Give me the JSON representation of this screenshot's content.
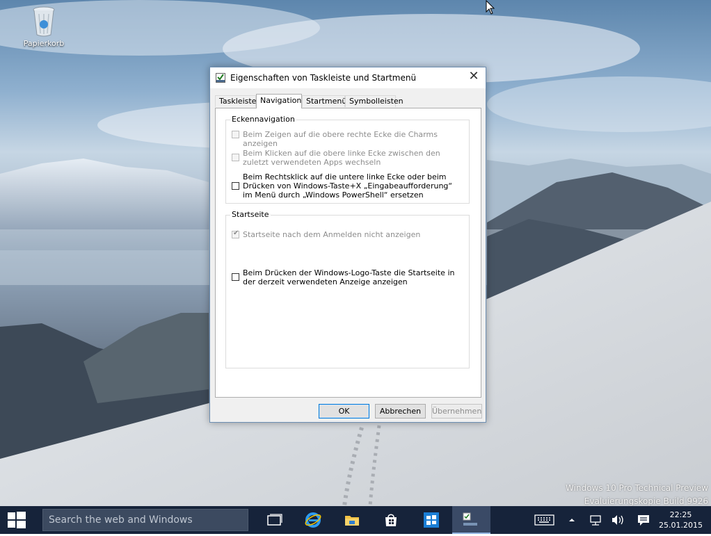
{
  "desktop": {
    "recycle_bin_label": "Papierkorb",
    "watermark_line1": "Windows 10 Pro Technical Preview",
    "watermark_line2": "Evaluierungskopie Build 9926"
  },
  "dialog": {
    "title": "Eigenschaften von Taskleiste und Startmenü",
    "close_glyph": "✕",
    "tabs": [
      {
        "label": "Taskleiste",
        "active": false
      },
      {
        "label": "Navigation",
        "active": true
      },
      {
        "label": "Startmenü",
        "active": false
      },
      {
        "label": "Symbolleisten",
        "active": false
      }
    ],
    "corner_group": {
      "label": "Eckennavigation",
      "options": [
        {
          "text": "Beim Zeigen auf die obere rechte Ecke die Charms anzeigen",
          "checked": false,
          "enabled": false
        },
        {
          "text": "Beim Klicken auf die obere linke Ecke zwischen den zuletzt verwendeten Apps wechseln",
          "checked": false,
          "enabled": false
        },
        {
          "text": "Beim Rechtsklick auf die untere linke Ecke oder beim Drücken von Windows-Taste+X „Eingabeaufforderung“ im Menü durch „Windows PowerShell“ ersetzen",
          "checked": false,
          "enabled": true
        }
      ]
    },
    "start_group": {
      "label": "Startseite",
      "options": [
        {
          "text": "Startseite nach dem Anmelden nicht anzeigen",
          "checked": true,
          "enabled": false
        },
        {
          "text": "Beim Drücken der Windows-Logo-Taste die Startseite in der derzeit verwendeten Anzeige anzeigen",
          "checked": false,
          "enabled": true
        }
      ]
    },
    "buttons": {
      "ok": "OK",
      "cancel": "Abbrechen",
      "apply": "Übernehmen"
    }
  },
  "taskbar": {
    "search_placeholder": "Search the web and Windows",
    "time": "22:25",
    "date": "25.01.2015",
    "icons": [
      "task-view-icon",
      "internet-explorer-icon",
      "file-explorer-icon",
      "store-icon",
      "app-icon",
      "taskbar-properties-icon"
    ],
    "tray_icons": [
      "keyboard-icon",
      "show-hidden-icons-icon",
      "network-icon",
      "volume-icon",
      "action-center-icon"
    ]
  },
  "colors": {
    "taskbar": "#16233a",
    "accent": "#0078d7"
  }
}
